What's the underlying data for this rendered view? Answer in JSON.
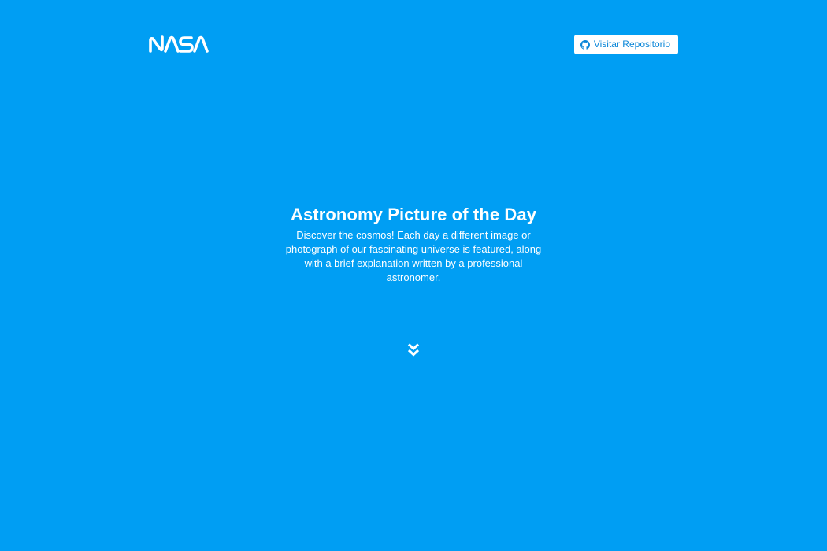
{
  "header": {
    "logo_text": "NASA",
    "repo_button_label": "Visitar Repositorio",
    "repo_button_icon": "github-icon"
  },
  "hero": {
    "title": "Astronomy Picture of the Day",
    "description": "Discover the cosmos! Each day a different image or photograph of our fascinating universe is featured, along with a brief explanation written by a professional astronomer."
  },
  "scroll": {
    "icon": "double-chevron-down-icon"
  },
  "colors": {
    "background": "#009ef3",
    "text": "#ffffff",
    "button_bg": "#ffffff",
    "button_text": "#0a86d8"
  }
}
